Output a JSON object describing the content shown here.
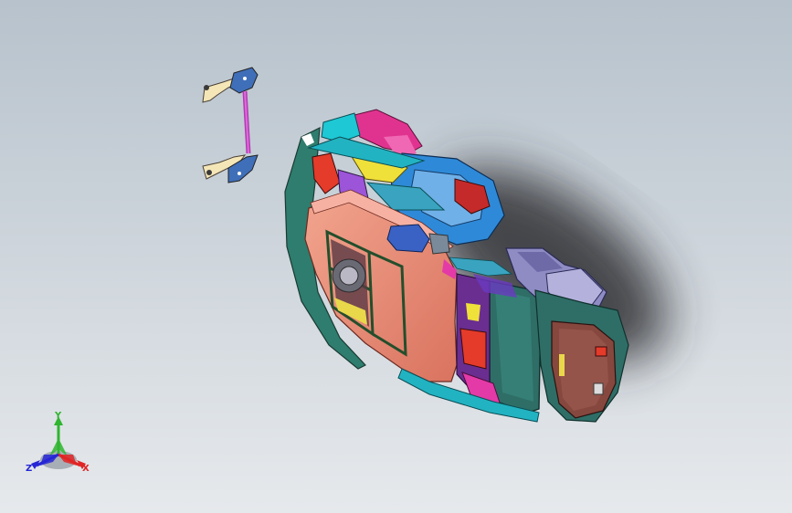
{
  "viewport": {
    "background_top": "#b7c2cc",
    "background_bottom": "#e6e9ec"
  },
  "triad": {
    "x_label": "X",
    "y_label": "Y",
    "z_label": "Z",
    "x_color": "#e02424",
    "y_color": "#2fb52f",
    "z_color": "#2626d6"
  },
  "model": {
    "body_color": "#ec8a76",
    "door_color": "#2e6e66",
    "rear_color": "#86473e"
  }
}
